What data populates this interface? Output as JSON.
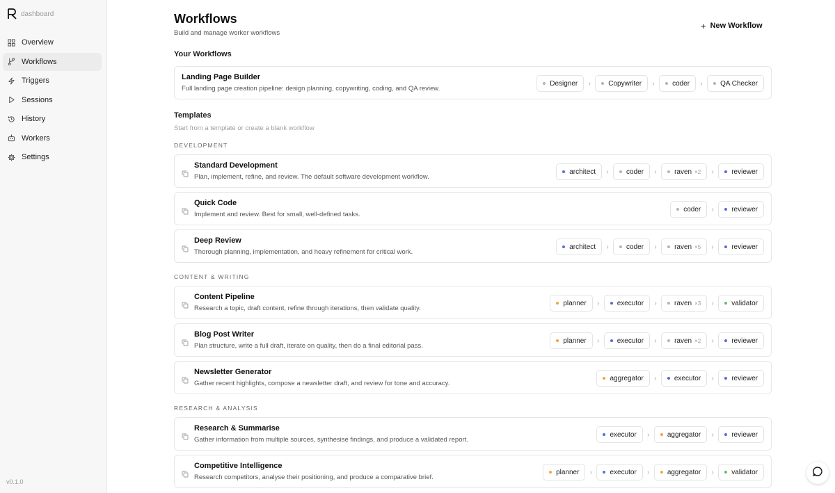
{
  "app": {
    "brand": "dashboard",
    "version": "v0.1.0"
  },
  "colors": {
    "accent_blue": "#5a6bd8",
    "accent_orange": "#f0a640",
    "accent_green": "#5cc46a",
    "dot_gray": "#b5b5b5"
  },
  "sidebar": {
    "items": [
      {
        "label": "Overview",
        "icon": "grid-icon",
        "active": false
      },
      {
        "label": "Workflows",
        "icon": "branch-icon",
        "active": true
      },
      {
        "label": "Triggers",
        "icon": "bolt-icon",
        "active": false
      },
      {
        "label": "Sessions",
        "icon": "play-icon",
        "active": false
      },
      {
        "label": "History",
        "icon": "history-icon",
        "active": false
      },
      {
        "label": "Workers",
        "icon": "robot-icon",
        "active": false
      },
      {
        "label": "Settings",
        "icon": "gear-icon",
        "active": false
      }
    ]
  },
  "header": {
    "title": "Workflows",
    "subtitle": "Build and manage worker workflows",
    "new_button": "New Workflow"
  },
  "your_workflows": {
    "label": "Your Workflows",
    "items": [
      {
        "title": "Landing Page Builder",
        "description": "Full landing page creation pipeline: design planning, copywriting, coding, and QA review.",
        "steps": [
          {
            "label": "Designer",
            "color": "gray"
          },
          {
            "label": "Copywriter",
            "color": "gray"
          },
          {
            "label": "coder",
            "color": "gray"
          },
          {
            "label": "QA Checker",
            "color": "gray"
          }
        ]
      }
    ]
  },
  "templates": {
    "label": "Templates",
    "subtitle": "Start from a template or create a blank workflow",
    "categories": [
      {
        "name": "DEVELOPMENT",
        "items": [
          {
            "title": "Standard Development",
            "description": "Plan, implement, refine, and review. The default software development workflow.",
            "steps": [
              {
                "label": "architect",
                "color": "blue"
              },
              {
                "label": "coder",
                "color": "gray"
              },
              {
                "label": "raven",
                "color": "gray",
                "mult": "×2"
              },
              {
                "label": "reviewer",
                "color": "blue"
              }
            ]
          },
          {
            "title": "Quick Code",
            "description": "Implement and review. Best for small, well-defined tasks.",
            "steps": [
              {
                "label": "coder",
                "color": "gray"
              },
              {
                "label": "reviewer",
                "color": "blue"
              }
            ]
          },
          {
            "title": "Deep Review",
            "description": "Thorough planning, implementation, and heavy refinement for critical work.",
            "steps": [
              {
                "label": "architect",
                "color": "blue"
              },
              {
                "label": "coder",
                "color": "gray"
              },
              {
                "label": "raven",
                "color": "gray",
                "mult": "×5"
              },
              {
                "label": "reviewer",
                "color": "blue"
              }
            ]
          }
        ]
      },
      {
        "name": "CONTENT & WRITING",
        "items": [
          {
            "title": "Content Pipeline",
            "description": "Research a topic, draft content, refine through iterations, then validate quality.",
            "steps": [
              {
                "label": "planner",
                "color": "orange"
              },
              {
                "label": "executor",
                "color": "blue"
              },
              {
                "label": "raven",
                "color": "gray",
                "mult": "×3"
              },
              {
                "label": "validator",
                "color": "green"
              }
            ]
          },
          {
            "title": "Blog Post Writer",
            "description": "Plan structure, write a full draft, iterate on quality, then do a final editorial pass.",
            "steps": [
              {
                "label": "planner",
                "color": "orange"
              },
              {
                "label": "executor",
                "color": "blue"
              },
              {
                "label": "raven",
                "color": "gray",
                "mult": "×2"
              },
              {
                "label": "reviewer",
                "color": "blue"
              }
            ]
          },
          {
            "title": "Newsletter Generator",
            "description": "Gather recent highlights, compose a newsletter draft, and review for tone and accuracy.",
            "steps": [
              {
                "label": "aggregator",
                "color": "orange"
              },
              {
                "label": "executor",
                "color": "blue"
              },
              {
                "label": "reviewer",
                "color": "blue"
              }
            ]
          }
        ]
      },
      {
        "name": "RESEARCH & ANALYSIS",
        "items": [
          {
            "title": "Research & Summarise",
            "description": "Gather information from multiple sources, synthesise findings, and produce a validated report.",
            "steps": [
              {
                "label": "executor",
                "color": "blue"
              },
              {
                "label": "aggregator",
                "color": "orange"
              },
              {
                "label": "reviewer",
                "color": "blue"
              }
            ]
          },
          {
            "title": "Competitive Intelligence",
            "description": "Research competitors, analyse their positioning, and produce a comparative brief.",
            "steps": [
              {
                "label": "planner",
                "color": "orange"
              },
              {
                "label": "executor",
                "color": "blue"
              },
              {
                "label": "aggregator",
                "color": "orange"
              },
              {
                "label": "validator",
                "color": "green"
              }
            ]
          }
        ]
      }
    ]
  }
}
